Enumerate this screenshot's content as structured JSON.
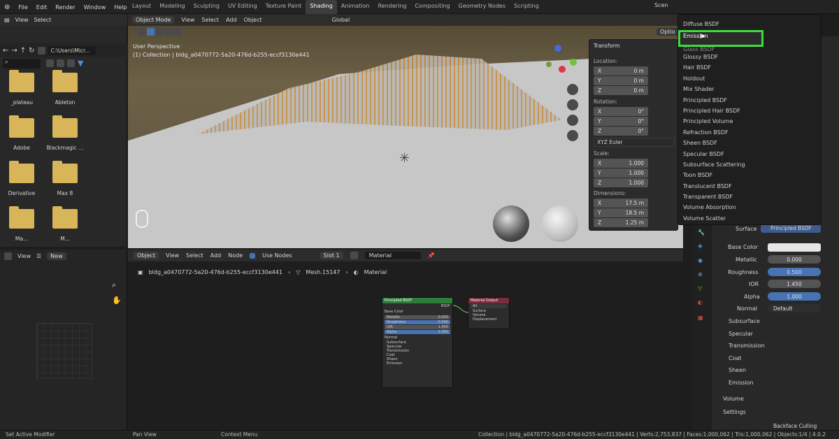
{
  "menubar": {
    "items": [
      "File",
      "Edit",
      "Render",
      "Window",
      "Help"
    ]
  },
  "workspace_tabs": [
    "Layout",
    "Modeling",
    "Sculpting",
    "UV Editing",
    "Texture Paint",
    "Shading",
    "Animation",
    "Rendering",
    "Compositing",
    "Geometry Nodes",
    "Scripting"
  ],
  "active_tab": "Shading",
  "scene_label": "Scen",
  "file_browser": {
    "header": [
      "View",
      "Select"
    ],
    "path": "C:\\Users\\Micr...",
    "folders": [
      "_plateau",
      "Ableton",
      "Adobe",
      "Blackmagic ...",
      "Derivative",
      "Max 8",
      "Ma...",
      "M..."
    ]
  },
  "viewport": {
    "mode": "Object Mode",
    "menus": [
      "View",
      "Select",
      "Add",
      "Object"
    ],
    "orientation": "Global",
    "perspective": "User Perspective",
    "collection": "(1) Collection | bldg_a0470772-5a20-476d-b255-eccf3130e441",
    "options_label": "Optio"
  },
  "transform_panel": {
    "title": "Transform",
    "location_label": "Location:",
    "location": [
      {
        "axis": "X",
        "value": "0 m"
      },
      {
        "axis": "Y",
        "value": "0 m"
      },
      {
        "axis": "Z",
        "value": "0 m"
      }
    ],
    "rotation_label": "Rotation:",
    "rotation": [
      {
        "axis": "X",
        "value": "0°"
      },
      {
        "axis": "Y",
        "value": "0°"
      },
      {
        "axis": "Z",
        "value": "0°"
      }
    ],
    "rotation_mode": "XYZ Euler",
    "scale_label": "Scale:",
    "scale": [
      {
        "axis": "X",
        "value": "1.000"
      },
      {
        "axis": "Y",
        "value": "1.000"
      },
      {
        "axis": "Z",
        "value": "1.000"
      }
    ],
    "dimensions_label": "Dimensions:",
    "dimensions": [
      {
        "axis": "X",
        "value": "17.5 m"
      },
      {
        "axis": "Y",
        "value": "18.5 m"
      },
      {
        "axis": "Z",
        "value": "1.25 m"
      }
    ]
  },
  "node_editor": {
    "object": "Object",
    "menus": [
      "View",
      "Select",
      "Add",
      "Node"
    ],
    "use_nodes": "Use Nodes",
    "slot": "Slot 1",
    "material": "Material",
    "breadcrumb": [
      "bldg_a0470772-5a20-476d-b255-eccf3130e441",
      "Mesh.15147",
      "Material"
    ],
    "bsdf_node": {
      "title": "Principled BSDF",
      "out": "BSDF",
      "rows": [
        "Base Color",
        "Metallic",
        "Roughness",
        "IOR",
        "Alpha",
        "Normal",
        "Subsurface",
        "Specular",
        "Transmission",
        "Coat",
        "Sheen",
        "Emission"
      ],
      "values": [
        "0.000",
        "0.500",
        "1.450",
        "1.000"
      ]
    },
    "output_node": {
      "title": "Material Output",
      "target": "All",
      "rows": [
        "Surface",
        "Volume",
        "Displacement"
      ]
    }
  },
  "left_panel": {
    "view": "View",
    "new": "New"
  },
  "shader_dropdown": {
    "items": [
      "Diffuse BSDF",
      "Emission",
      "Glass BSDF",
      "Glossy BSDF",
      "Hair BSDF",
      "Holdout",
      "Mix Shader",
      "Principled BSDF",
      "Principled Hair BSDF",
      "Principled Volume",
      "Refraction BSDF",
      "Sheen BSDF",
      "Specular BSDF",
      "Subsurface Scattering",
      "Toon BSDF",
      "Translucent BSDF",
      "Transparent BSDF",
      "Volume Absorption",
      "Volume Scatter"
    ],
    "highlighted": "Emission",
    "highlight_color": "#3ddc3d"
  },
  "properties": {
    "surface_label": "Surface",
    "surface_value": "Principled BSDF",
    "fields": [
      {
        "label": "Base Color",
        "value": ""
      },
      {
        "label": "Metallic",
        "value": "0.000"
      },
      {
        "label": "Roughness",
        "value": "0.500"
      },
      {
        "label": "IOR",
        "value": "1.450"
      },
      {
        "label": "Alpha",
        "value": "1.000"
      },
      {
        "label": "Normal",
        "value": "Default"
      }
    ],
    "sections": [
      "Subsurface",
      "Specular",
      "Transmission",
      "Coat",
      "Sheen",
      "Emission"
    ],
    "panels": [
      "Volume",
      "Settings"
    ],
    "backface": "Backface Culling"
  },
  "statusbar": {
    "left": "Set Active Modifier",
    "mid1": "Pan View",
    "mid2": "Context Menu",
    "right": "Collection | bldg_a0470772-5a20-476d-b255-eccf3130e441 | Verts:2,753,837 | Faces:1,000,062 | Tris:1,000,062 | Objects:1/4 | 4.0.2"
  }
}
